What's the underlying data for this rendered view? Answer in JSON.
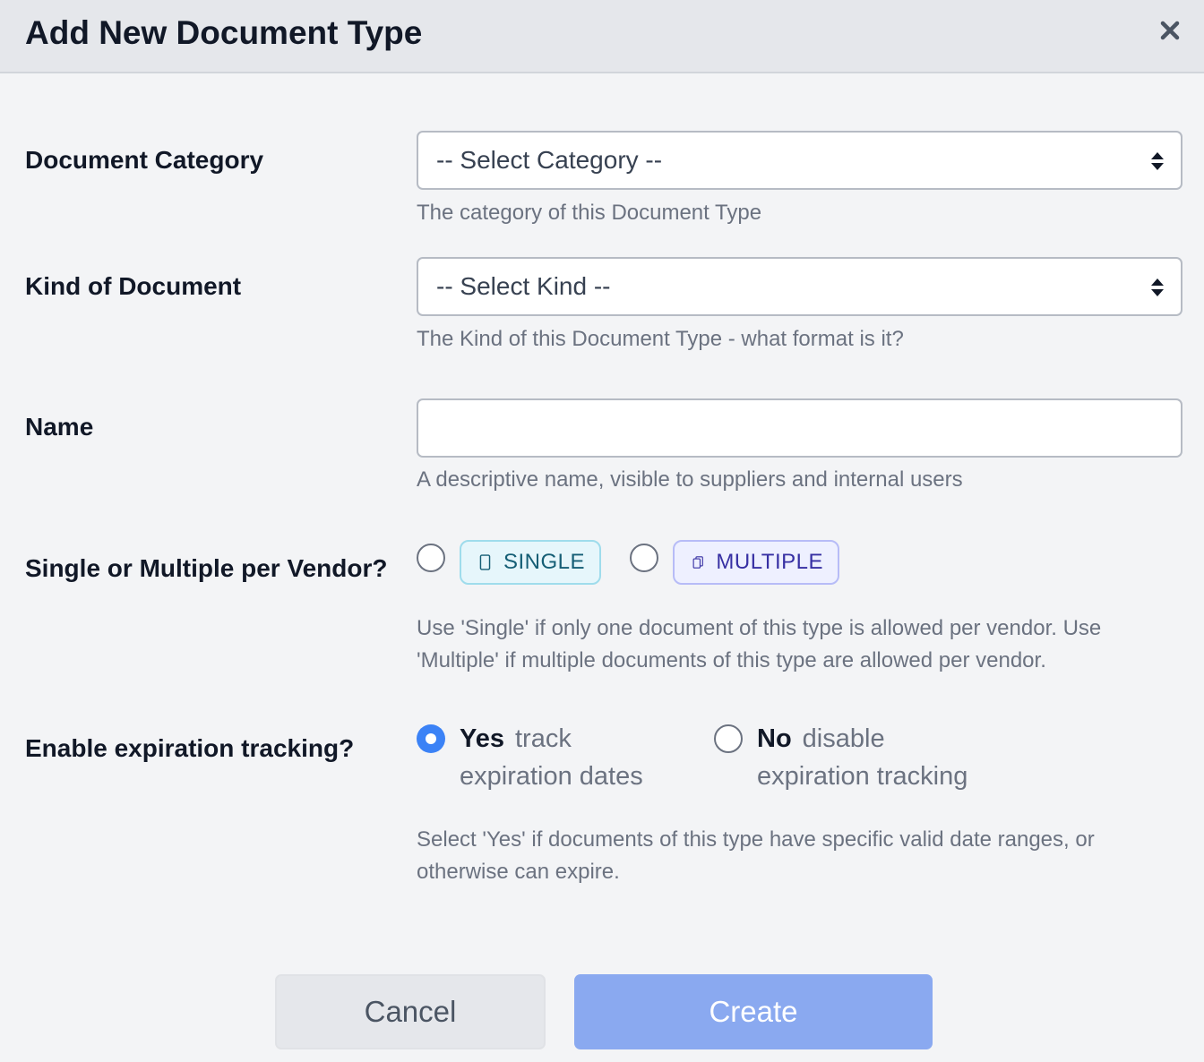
{
  "dialog": {
    "title": "Add New Document Type",
    "close_icon": "close-icon"
  },
  "fields": {
    "category": {
      "label": "Document Category",
      "selected": "-- Select Category --",
      "help": "The category of this Document Type"
    },
    "kind": {
      "label": "Kind of Document",
      "selected": "-- Select Kind --",
      "help": "The Kind of this Document Type - what format is it?"
    },
    "name": {
      "label": "Name",
      "value": "",
      "placeholder": "",
      "help": "A descriptive name, visible to suppliers and internal users"
    },
    "cardinality": {
      "label": "Single or Multiple per Vendor?",
      "options": [
        {
          "label": "SINGLE",
          "icon": "single-document-icon",
          "checked": false
        },
        {
          "label": "MULTIPLE",
          "icon": "multiple-documents-icon",
          "checked": false
        }
      ],
      "help_line1": "Use 'Single' if only one document of this type is allowed per vendor. Use",
      "help_line2": "'Multiple' if multiple documents of this type are allowed per vendor."
    },
    "expiration": {
      "label": "Enable expiration tracking?",
      "options": [
        {
          "title": "Yes",
          "desc_line1": "track",
          "desc_line2": "expiration dates",
          "checked": true
        },
        {
          "title": "No",
          "desc_line1": "disable",
          "desc_line2": "expiration tracking",
          "checked": false
        }
      ],
      "help_line1": "Select 'Yes' if documents of this type have specific valid date ranges, or",
      "help_line2": "otherwise can expire."
    }
  },
  "actions": {
    "cancel_label": "Cancel",
    "create_label": "Create"
  },
  "colors": {
    "accent": "#3b82f6",
    "create_button": "#8aa9f0",
    "single_chip": "#e6f6fb",
    "multiple_chip": "#eef0ff"
  }
}
